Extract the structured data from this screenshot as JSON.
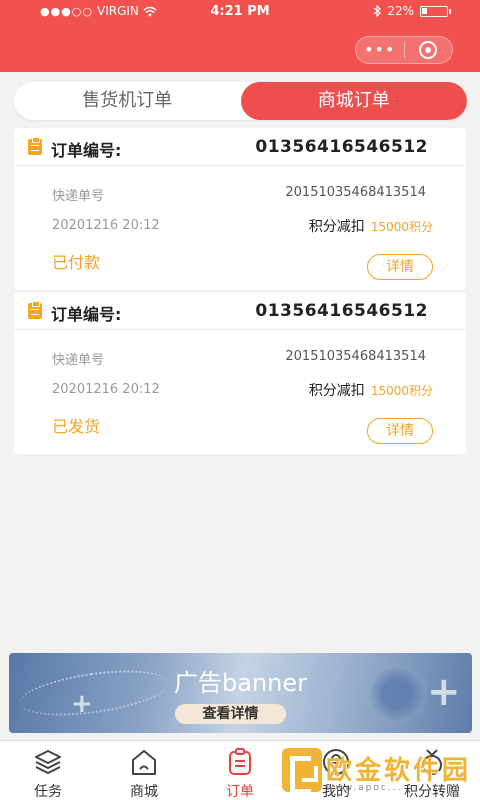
{
  "status_bar": {
    "carrier": "VIRGIN",
    "time": "4:21 PM",
    "battery": "22%",
    "battery_level": 0.22
  },
  "capsule": {
    "more": "•••"
  },
  "tabs": [
    {
      "label": "售货机订单",
      "active": false
    },
    {
      "label": "商城订单",
      "active": true
    }
  ],
  "orders": [
    {
      "order_label": "订单编号:",
      "order_no": "01356416546512",
      "express_label": "快递单号",
      "express_no": "20151035468413514",
      "date": "20201216 20:12",
      "deduct_label": "积分减扣",
      "points": "15000积分",
      "status": "已付款",
      "detail_label": "详情"
    },
    {
      "order_label": "订单编号:",
      "order_no": "01356416546512",
      "express_label": "快递单号",
      "express_no": "20151035468413514",
      "date": "20201216 20:12",
      "deduct_label": "积分减扣",
      "points": "15000积分",
      "status": "已发货",
      "detail_label": "详情"
    }
  ],
  "banner": {
    "title": "广告banner",
    "button": "查看详情"
  },
  "bottom_nav": [
    {
      "label": "任务",
      "icon": "layers-icon",
      "active": false
    },
    {
      "label": "商城",
      "icon": "home-icon",
      "active": false
    },
    {
      "label": "订单",
      "icon": "order-icon",
      "active": true
    },
    {
      "label": "我的",
      "icon": "user-icon",
      "active": false
    },
    {
      "label": "积分转赠",
      "icon": "gift-icon",
      "active": false
    }
  ],
  "watermark": {
    "text": "欧金软件园",
    "url": "www.apoc..."
  },
  "colors": {
    "accent": "#f1524f",
    "highlight": "#f5a524",
    "nav_active": "#e8423f"
  }
}
